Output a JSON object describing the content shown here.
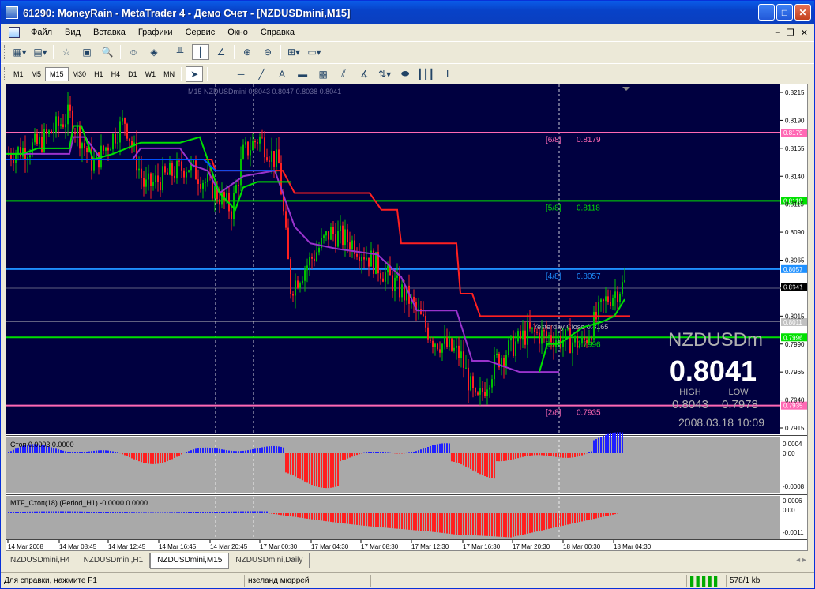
{
  "window": {
    "title": "61290: MoneyRain - MetaTrader 4 - Демо Счет - [NZDUSDmini,M15]"
  },
  "menu": [
    "Файл",
    "Вид",
    "Вставка",
    "Графики",
    "Сервис",
    "Окно",
    "Справка"
  ],
  "timeframes": [
    "M1",
    "M5",
    "M15",
    "M30",
    "H1",
    "H4",
    "D1",
    "W1",
    "MN"
  ],
  "active_timeframe": "M15",
  "chart": {
    "header": "M15 NZDUSDmini 0.8043 0.8047 0.8038 0.8041",
    "symbol": "NZDUSDm",
    "bid": "0.8041",
    "high_label": "HIGH",
    "low_label": "LOW",
    "high": "0.8043",
    "low": "0.7978",
    "datetime": "2008.03.18 10:09",
    "yesterday_close": "Yesterday Close 0.8165",
    "price_ticks": [
      "0.8215",
      "0.8190",
      "0.8165",
      "0.8140",
      "0.8115",
      "0.8090",
      "0.8065",
      "0.8040",
      "0.8015",
      "0.7990",
      "0.7965",
      "0.7940",
      "0.7915"
    ],
    "murrey_levels": [
      {
        "label": "[6/8]",
        "value": "0.8179",
        "color": "#ff69b4"
      },
      {
        "label": "[5/8]",
        "value": "0.8118",
        "color": "#00e000"
      },
      {
        "label": "[4/8]",
        "value": "0.8057",
        "color": "#1e90ff"
      },
      {
        "label": "[3/8]",
        "value": "0.7996",
        "color": "#00e000"
      },
      {
        "label": "[2/8]",
        "value": "0.7935",
        "color": "#ff69b4"
      }
    ],
    "current_price_tag": "0.8041",
    "yesterday_tag": "0.8011"
  },
  "indicator1": {
    "label": "Стоп 0.0003 0.0000",
    "ticks": [
      "0.0004",
      "0.00",
      "-0.0008"
    ]
  },
  "indicator2": {
    "label": "MTF_Стоп(18) (Period_H1) -0.0000 0.0000",
    "ticks": [
      "0.0006",
      "0.00",
      "-0.0011"
    ]
  },
  "time_axis": [
    "14 Mar 2008",
    "14 Mar 08:45",
    "14 Mar 12:45",
    "14 Mar 16:45",
    "14 Mar 20:45",
    "17 Mar 00:30",
    "17 Mar 04:30",
    "17 Mar 08:30",
    "17 Mar 12:30",
    "17 Mar 16:30",
    "17 Mar 20:30",
    "18 Mar 00:30",
    "18 Mar 04:30"
  ],
  "tabs": [
    "NZDUSDmini,H4",
    "NZDUSDmini,H1",
    "NZDUSDmini,M15",
    "NZDUSDmini,Daily"
  ],
  "active_tab": "NZDUSDmini,M15",
  "status": {
    "help": "Для справки, нажмите F1",
    "profile": "нзеланд мюррей",
    "traffic": "578/1 kb"
  }
}
